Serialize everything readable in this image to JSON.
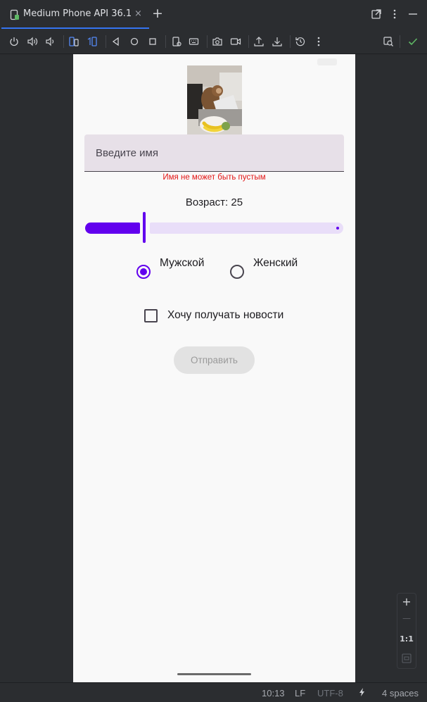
{
  "ide": {
    "tab": {
      "title": "Medium Phone API 36.1",
      "close": "×"
    },
    "add_tab": "+",
    "zoom": {
      "plus": "+",
      "minus": "—",
      "actual_size": "1:1"
    },
    "status_bar": {
      "cursor": "10:13",
      "line_ending": "LF",
      "encoding": "UTF-8",
      "indent": "4 spaces"
    },
    "icons": {
      "toolbar": [
        "power-icon",
        "volume-up-icon",
        "volume-down-icon",
        "rotate-left-icon",
        "rotate-right-icon",
        "back-icon",
        "home-icon",
        "overview-icon",
        "fold-icon",
        "keyboard-icon",
        "camera-icon",
        "record-icon",
        "upload-icon",
        "download-icon",
        "snapshot-history-icon",
        "more-icon",
        "device-mirroring-icon",
        "check-icon"
      ]
    }
  },
  "app": {
    "name_field": {
      "placeholder": "Введите имя",
      "value": ""
    },
    "error": "Имя не может быть пустым",
    "age_label": "Возраст: 25",
    "slider": {
      "value": 25,
      "min": 0,
      "max": 100,
      "fraction": 0.23
    },
    "gender": {
      "options": [
        "Мужской",
        "Женский"
      ],
      "selected": "Мужской"
    },
    "newsletter": {
      "label": "Хочу получать новости",
      "checked": false
    },
    "submit_label": "Отправить",
    "colors": {
      "accent": "#6200ee",
      "accent_track": "#e9def9",
      "error": "#e31616",
      "field_bg": "#e7e0e8"
    }
  }
}
